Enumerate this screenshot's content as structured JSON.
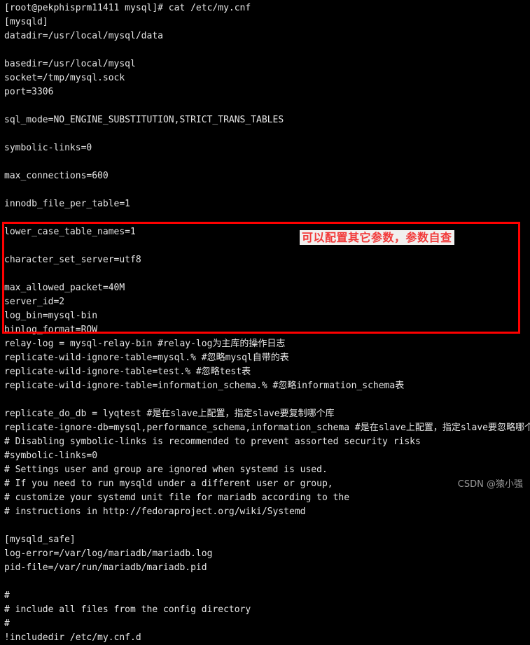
{
  "terminal": {
    "title": "cat /etc/my.cnf",
    "background_color": "#000000",
    "text_color": "#e6e6e6",
    "prompt": "[root@pekphisprm11411 mysql]# cat /etc/my.cnf",
    "lines": [
      "[root@pekphisprm11411 mysql]# cat /etc/my.cnf",
      "[mysqld]",
      "datadir=/usr/local/mysql/data",
      "",
      "basedir=/usr/local/mysql",
      "socket=/tmp/mysql.sock",
      "port=3306",
      "",
      "sql_mode=NO_ENGINE_SUBSTITUTION,STRICT_TRANS_TABLES",
      "",
      "symbolic-links=0",
      "",
      "max_connections=600",
      "",
      "innodb_file_per_table=1",
      "",
      "lower_case_table_names=1",
      "",
      "character_set_server=utf8",
      "",
      "max_allowed_packet=40M",
      "server_id=2",
      "log_bin=mysql-bin",
      "binlog_format=ROW",
      "relay-log = mysql-relay-bin #relay-log为主库的操作日志",
      "replicate-wild-ignore-table=mysql.% #忽略mysql自带的表",
      "replicate-wild-ignore-table=test.% #忽略test表",
      "replicate-wild-ignore-table=information_schema.% #忽略information_schema表",
      "",
      "replicate_do_db = lyqtest #是在slave上配置，指定slave要复制哪个库",
      "replicate-ignore-db=mysql,performance_schema,information_schema #是在slave上配置，指定slave要忽略哪个库",
      "# Disabling symbolic-links is recommended to prevent assorted security risks",
      "#symbolic-links=0",
      "# Settings user and group are ignored when systemd is used.",
      "# If you need to run mysqld under a different user or group,",
      "# customize your systemd unit file for mariadb according to the",
      "# instructions in http://fedoraproject.org/wiki/Systemd",
      "",
      "[mysqld_safe]",
      "log-error=/var/log/mariadb/mariadb.log",
      "pid-file=/var/run/mariadb/mariadb.pid",
      "",
      "#",
      "# include all files from the config directory",
      "#",
      "!includedir /etc/my.cnf.d"
    ]
  },
  "annotation": {
    "text": "可以配置其它参数，参数自查",
    "text_color": "#f23a3a",
    "background_color": "#f2f0ef"
  },
  "highlight_box": {
    "border_color": "#ff0000",
    "border_width": "3px",
    "covers_lines": "server_id=2 through replicate-ignore-db"
  },
  "watermark": {
    "text": "CSDN @猿小强",
    "color": "#9a9a9a"
  }
}
